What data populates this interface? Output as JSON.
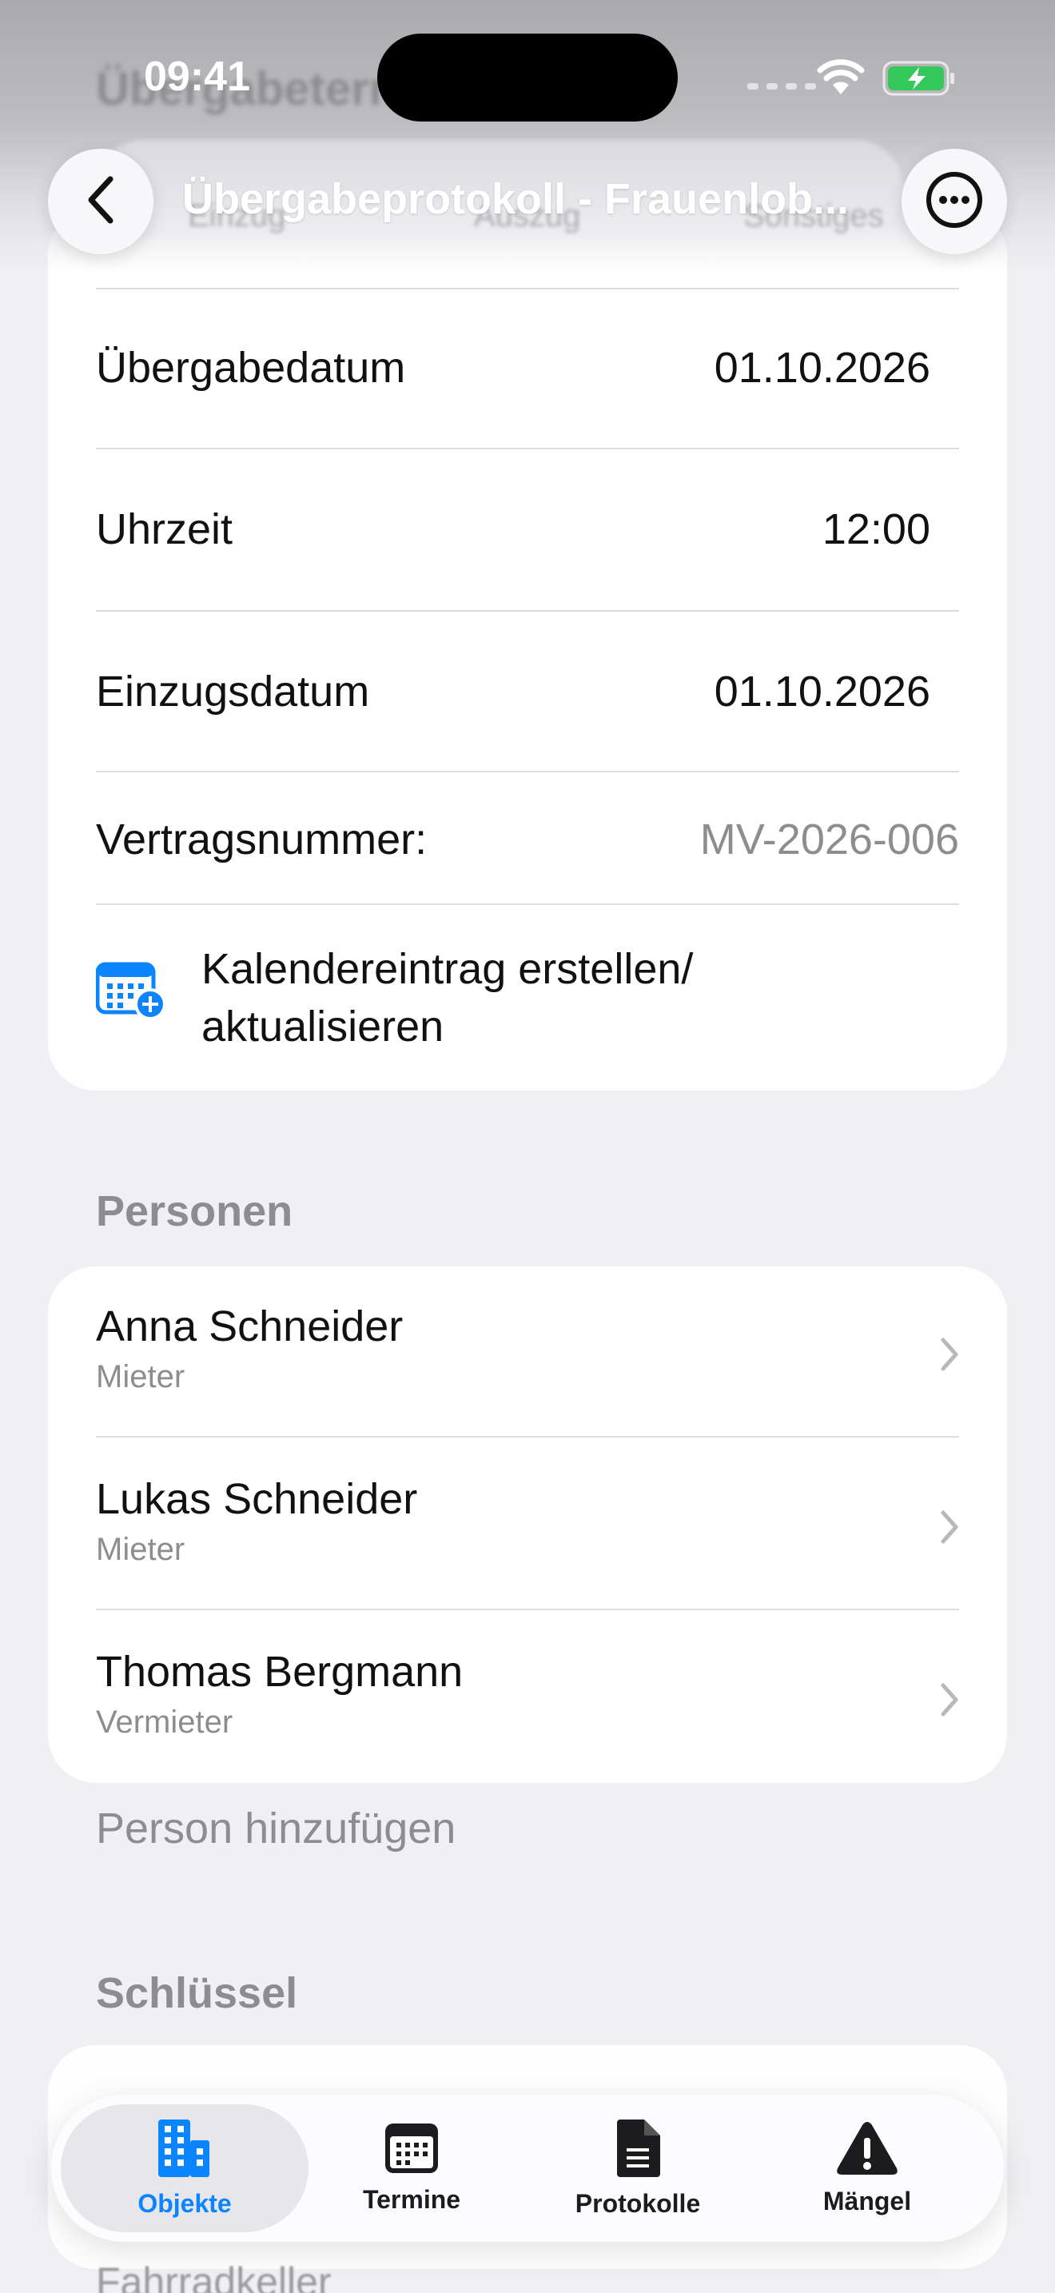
{
  "status": {
    "time": "09:41"
  },
  "header": {
    "title": "Übergabeprotokoll - Frauenlob...",
    "ghost_title": "Übergabeterm",
    "ghost_tabs": [
      "Einzug",
      "Auszug",
      "Sonstiges"
    ]
  },
  "details": {
    "rows": [
      {
        "label": "Übergabedatum",
        "value": "01.10.2026"
      },
      {
        "label": "Uhrzeit",
        "value": "12:00"
      },
      {
        "label": "Einzugsdatum",
        "value": "01.10.2026"
      },
      {
        "label": "Vertragsnummer:",
        "value": "MV-2026-006"
      }
    ],
    "calendar_action_line1": "Kalendereintrag erstellen/",
    "calendar_action_line2": "aktualisieren"
  },
  "persons": {
    "heading": "Personen",
    "items": [
      {
        "name": "Anna Schneider",
        "role": "Mieter"
      },
      {
        "name": "Lukas Schneider",
        "role": "Mieter"
      },
      {
        "name": "Thomas Bergmann",
        "role": "Vermieter"
      }
    ],
    "add_label": "Person hinzufügen"
  },
  "keys": {
    "heading": "Schlüssel",
    "ghost_item": "Fahrradkeller"
  },
  "tabbar": {
    "items": [
      {
        "label": "Objekte",
        "icon": "building-icon",
        "active": true
      },
      {
        "label": "Termine",
        "icon": "calendar-icon",
        "active": false
      },
      {
        "label": "Protokolle",
        "icon": "document-icon",
        "active": false
      },
      {
        "label": "Mängel",
        "icon": "warning-icon",
        "active": false
      }
    ]
  },
  "colors": {
    "accent": "#0a84ff",
    "battery": "#34c759",
    "background": "#efeff4"
  }
}
